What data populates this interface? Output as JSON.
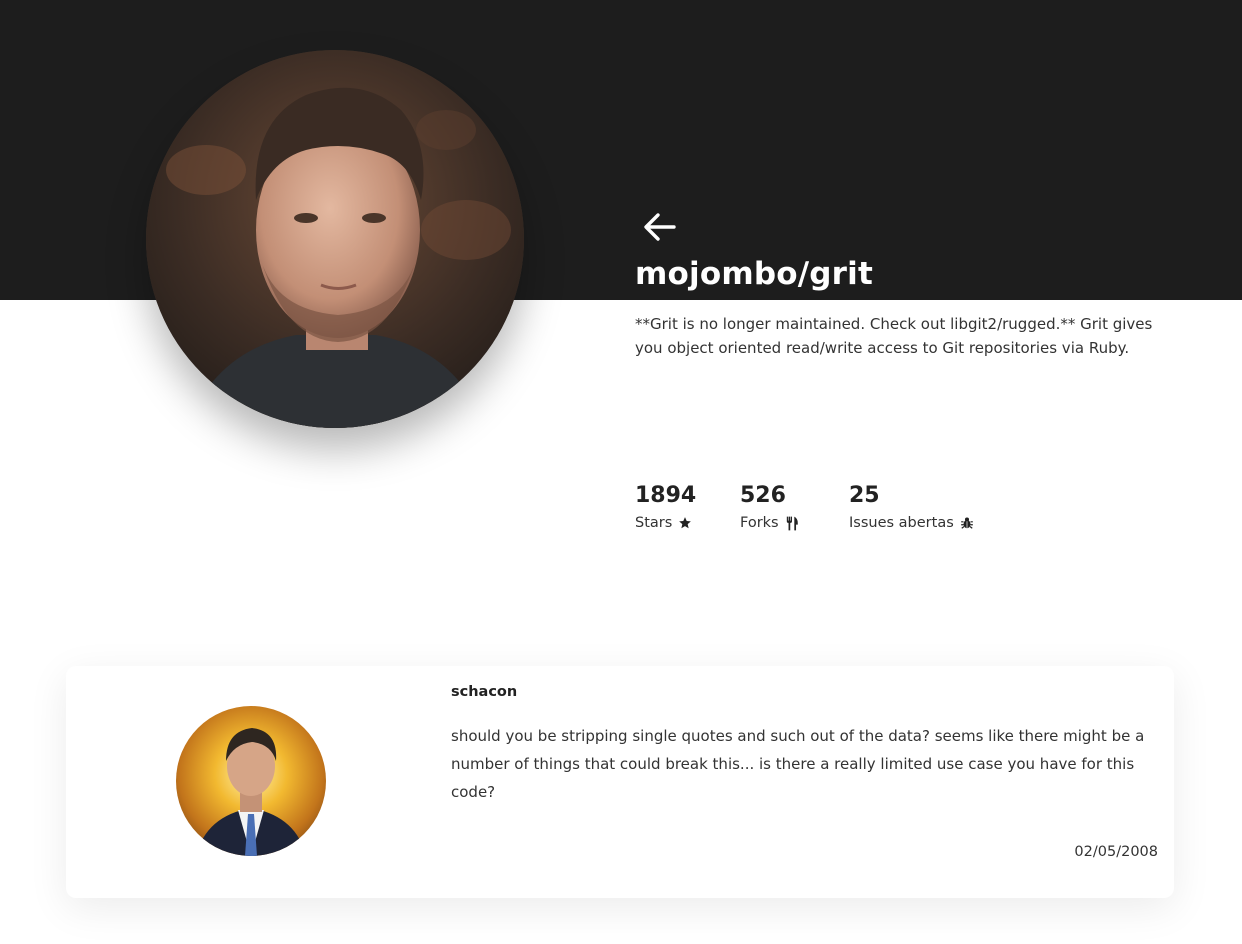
{
  "repo": {
    "full_name": "mojombo/grit",
    "description": "**Grit is no longer maintained. Check out libgit2/rugged.** Grit gives you object oriented read/write access to Git repositories via Ruby."
  },
  "stats": [
    {
      "value": "1894",
      "label": "Stars",
      "icon": "star-icon"
    },
    {
      "value": "526",
      "label": "Forks",
      "icon": "fork-knife-icon"
    },
    {
      "value": "25",
      "label": "Issues abertas",
      "icon": "bug-icon"
    }
  ],
  "issue": {
    "user": "schacon",
    "body": "should you be stripping single quotes and such out of the data? seems like there might be a number of things that could break this... is there a really limited use case you have for this code?",
    "date": "02/05/2008"
  },
  "colors": {
    "header_bg": "#1d1d1d",
    "page_bg": "#ffffff",
    "title_text": "#ffffff",
    "body_text": "#333333"
  },
  "icons": {
    "back": "arrow-left-icon",
    "owner_avatar": "owner-avatar",
    "issue_avatar": "issue-author-avatar"
  }
}
